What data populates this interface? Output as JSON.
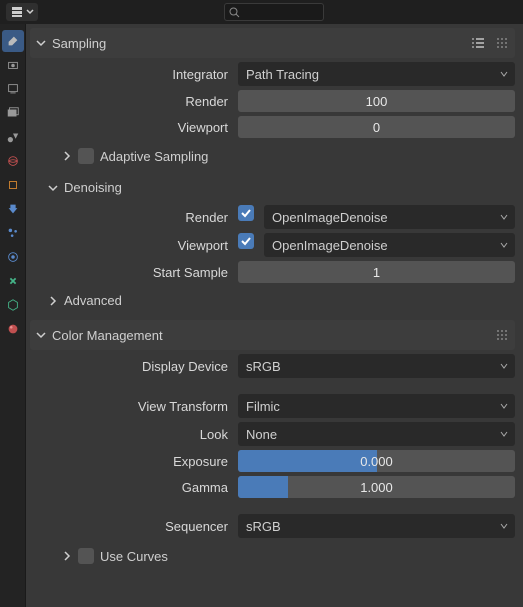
{
  "search": {
    "placeholder": ""
  },
  "panels": {
    "sampling": {
      "title": "Sampling",
      "integrator_label": "Integrator",
      "integrator_value": "Path Tracing",
      "render_label": "Render",
      "render_value": "100",
      "viewport_label": "Viewport",
      "viewport_value": "0",
      "adaptive": "Adaptive Sampling",
      "denoising": {
        "title": "Denoising",
        "render_label": "Render",
        "render_value": "OpenImageDenoise",
        "viewport_label": "Viewport",
        "viewport_value": "OpenImageDenoise",
        "start_label": "Start Sample",
        "start_value": "1"
      },
      "advanced": "Advanced"
    },
    "colormgmt": {
      "title": "Color Management",
      "display_device_label": "Display Device",
      "display_device_value": "sRGB",
      "view_transform_label": "View Transform",
      "view_transform_value": "Filmic",
      "look_label": "Look",
      "look_value": "None",
      "exposure_label": "Exposure",
      "exposure_value": "0.000",
      "gamma_label": "Gamma",
      "gamma_value": "1.000",
      "sequencer_label": "Sequencer",
      "sequencer_value": "sRGB",
      "use_curves": "Use Curves"
    }
  }
}
